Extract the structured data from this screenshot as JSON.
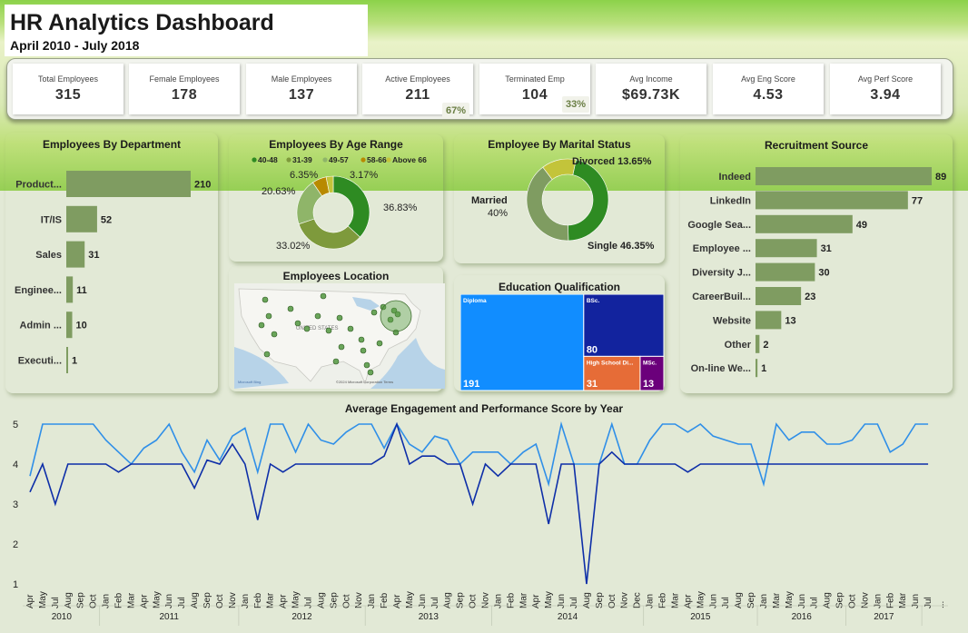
{
  "header": {
    "title": "HR Analytics Dashboard",
    "subtitle": "April 2010 - July 2018"
  },
  "kpis": [
    {
      "label": "Total Employees",
      "value": "315"
    },
    {
      "label": "Female Employees",
      "value": "178"
    },
    {
      "label": "Male Employees",
      "value": "137"
    },
    {
      "label": "Active Employees",
      "value": "211"
    },
    {
      "label": "Terminated Emp",
      "value": "104"
    },
    {
      "label": "Avg Income",
      "value": "$69.73K"
    },
    {
      "label": "Avg Eng Score",
      "value": "4.53"
    },
    {
      "label": "Avg Perf Score",
      "value": "3.94"
    }
  ],
  "badges": {
    "active_pct": "67%",
    "terminated_pct": "33%"
  },
  "colors": {
    "bar": "#7f9c61",
    "green1": "#2e8b22",
    "green2": "#5d8f3b",
    "green3": "#7e9a3c",
    "green4": "#8fb569",
    "yellow": "#c3c43a",
    "gold": "#b88a00",
    "line_light": "#2f8fe8",
    "line_dark": "#0d2ea8"
  },
  "chart_data": [
    {
      "type": "bar",
      "orientation": "horizontal",
      "title": "Employees By Department",
      "categories": [
        "Product...",
        "IT/IS",
        "Sales",
        "Enginee...",
        "Admin ...",
        "Executi..."
      ],
      "values": [
        210,
        52,
        31,
        11,
        10,
        1
      ]
    },
    {
      "type": "pie",
      "donut": true,
      "title": "Employees By Age Range",
      "legend": [
        "40-48",
        "31-39",
        "49-57",
        "58-66",
        "Above 66"
      ],
      "slices": [
        {
          "label": "40-48",
          "value": 36.83,
          "display": "36.83%"
        },
        {
          "label": "31-39",
          "value": 33.02,
          "display": "33.02%"
        },
        {
          "label": "49-57",
          "value": 20.63,
          "display": "20.63%"
        },
        {
          "label": "58-66",
          "value": 6.35,
          "display": "6.35%"
        },
        {
          "label": "Above 66",
          "value": 3.17,
          "display": "3.17%"
        }
      ]
    },
    {
      "type": "pie",
      "donut": true,
      "title": "Employee By Marital Status",
      "slices": [
        {
          "label": "Single",
          "value": 46.35,
          "display": "Single 46.35%"
        },
        {
          "label": "Married",
          "value": 40,
          "display": "Married 40%"
        },
        {
          "label": "Divorced",
          "value": 13.65,
          "display": "Divorced 13.65%"
        }
      ]
    },
    {
      "type": "bar",
      "orientation": "horizontal",
      "title": "Recruitment Source",
      "categories": [
        "Indeed",
        "LinkedIn",
        "Google Sea...",
        "Employee ...",
        "Diversity J...",
        "CareerBuil...",
        "Website",
        "Other",
        "On-line We..."
      ],
      "values": [
        89,
        77,
        49,
        31,
        30,
        23,
        13,
        2,
        1
      ]
    },
    {
      "type": "treemap",
      "title": "Education Qualification",
      "items": [
        {
          "label": "Diploma",
          "value": 191,
          "color": "#118dff"
        },
        {
          "label": "BSc.",
          "value": 80,
          "color": "#12239e"
        },
        {
          "label": "High School Di...",
          "value": 31,
          "color": "#e66c37"
        },
        {
          "label": "MSc.",
          "value": 13,
          "color": "#6b007b"
        }
      ]
    },
    {
      "type": "line",
      "title": "Average Engagement and Performance Score by Year",
      "ylim": [
        1,
        5
      ],
      "yticks": [
        "1",
        "2",
        "3",
        "4",
        "5"
      ],
      "x": [
        "Apr",
        "May",
        "Jul",
        "Aug",
        "Sep",
        "Oct",
        "Jan",
        "Feb",
        "Mar",
        "Apr",
        "May",
        "Jun",
        "Jul",
        "Aug",
        "Sep",
        "Oct",
        "Nov",
        "Jan",
        "Feb",
        "Mar",
        "Apr",
        "May",
        "Jul",
        "Aug",
        "Sep",
        "Oct",
        "Nov",
        "Jan",
        "Feb",
        "Apr",
        "May",
        "Jun",
        "Jul",
        "Aug",
        "Sep",
        "Oct",
        "Nov",
        "Jan",
        "Feb",
        "Mar",
        "Apr",
        "May",
        "Jun",
        "Jul",
        "Aug",
        "Sep",
        "Oct",
        "Nov",
        "Dec",
        "Jan",
        "Feb",
        "Mar",
        "Apr",
        "May",
        "Jun",
        "Jul",
        "Aug",
        "Sep",
        "Jan",
        "Mar",
        "May",
        "Jun",
        "Jul",
        "Aug",
        "Sep",
        "Oct",
        "Nov",
        "Jan",
        "Feb",
        "Mar",
        "Jun",
        "Jul",
        "..."
      ],
      "year_groups": [
        {
          "year": "2010",
          "count": 6
        },
        {
          "year": "2011",
          "count": 11
        },
        {
          "year": "2012",
          "count": 10
        },
        {
          "year": "2013",
          "count": 10
        },
        {
          "year": "2014",
          "count": 12
        },
        {
          "year": "2015",
          "count": 9
        },
        {
          "year": "2016",
          "count": 7
        },
        {
          "year": "2017",
          "count": 6
        }
      ],
      "series": [
        {
          "values": [
            3.7,
            5,
            5,
            5,
            5,
            5,
            4.6,
            4.3,
            4,
            4.4,
            4.6,
            5,
            4.3,
            3.8,
            4.6,
            4.1,
            4.7,
            4.9,
            3.8,
            5,
            5,
            4.3,
            5,
            4.6,
            4.5,
            4.8,
            5,
            5,
            4.4,
            5,
            4.5,
            4.3,
            4.7,
            4.6,
            4,
            4.3,
            4.3,
            4.3,
            4,
            4.3,
            4.5,
            3.5,
            5,
            4,
            4,
            4,
            5,
            4,
            4,
            4.6,
            5,
            5,
            4.8,
            5,
            4.7,
            4.6,
            4.5,
            4.5,
            3.5,
            5,
            4.6,
            4.8,
            4.8,
            4.5,
            4.5,
            4.6,
            5,
            5,
            4.3,
            4.5,
            5,
            5
          ]
        },
        {
          "values": [
            3.3,
            4,
            3,
            4,
            4,
            4,
            4,
            3.8,
            4,
            4,
            4,
            4,
            4,
            3.4,
            4.1,
            4,
            4.5,
            4,
            2.6,
            4,
            3.8,
            4,
            4,
            4,
            4,
            4,
            4,
            4,
            4.2,
            5,
            4,
            4.2,
            4.2,
            4,
            4,
            3,
            4,
            3.7,
            4,
            4,
            4,
            2.5,
            4,
            4,
            1,
            4,
            4.3,
            4,
            4,
            4,
            4,
            4,
            3.8,
            4,
            4,
            4,
            4,
            4,
            4,
            4,
            4,
            4,
            4,
            4,
            4,
            4,
            4,
            4,
            4,
            4,
            4,
            4
          ]
        }
      ]
    }
  ],
  "map": {
    "title": "Employees Location",
    "country_label": "UNITED STATES",
    "credit": "Microsoft Bing",
    "copyright": "©2024 Microsoft Corporation Terms"
  }
}
